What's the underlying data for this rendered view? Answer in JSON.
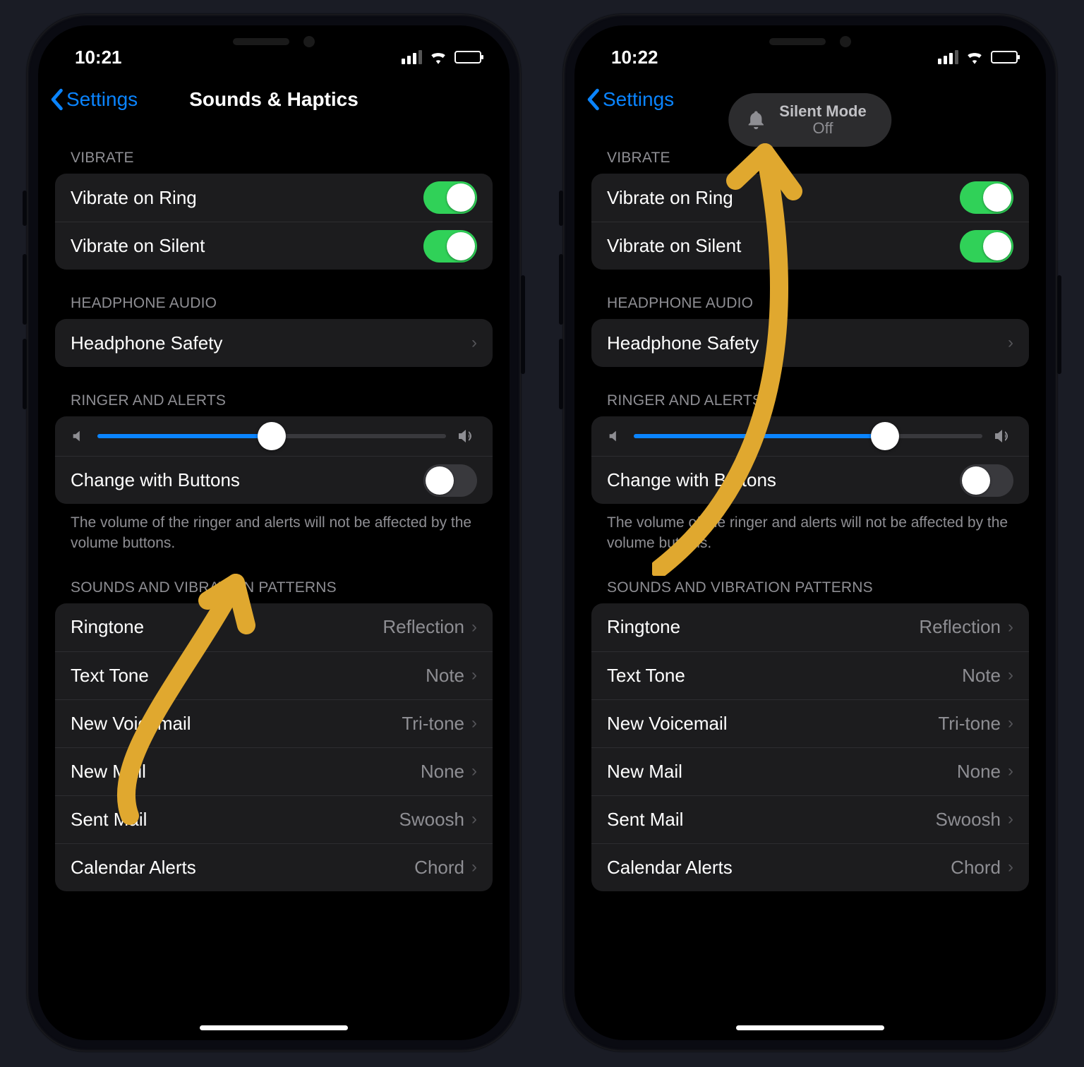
{
  "left": {
    "status": {
      "time": "10:21"
    },
    "nav": {
      "back": "Settings",
      "title": "Sounds & Haptics"
    },
    "vibrate": {
      "header": "VIBRATE",
      "ring": {
        "label": "Vibrate on Ring",
        "on": true
      },
      "silent": {
        "label": "Vibrate on Silent",
        "on": true
      }
    },
    "headphone": {
      "header": "HEADPHONE AUDIO",
      "safety": {
        "label": "Headphone Safety"
      }
    },
    "ringer": {
      "header": "RINGER AND ALERTS",
      "volume_pct": 50,
      "change": {
        "label": "Change with Buttons",
        "on": false
      },
      "footer": "The volume of the ringer and alerts will not be affected by the volume buttons."
    },
    "sounds": {
      "header": "SOUNDS AND VIBRATION PATTERNS",
      "items": [
        {
          "label": "Ringtone",
          "value": "Reflection"
        },
        {
          "label": "Text Tone",
          "value": "Note"
        },
        {
          "label": "New Voicemail",
          "value": "Tri-tone"
        },
        {
          "label": "New Mail",
          "value": "None"
        },
        {
          "label": "Sent Mail",
          "value": "Swoosh"
        },
        {
          "label": "Calendar Alerts",
          "value": "Chord"
        }
      ]
    }
  },
  "right": {
    "status": {
      "time": "10:22"
    },
    "nav": {
      "back": "Settings",
      "title": ""
    },
    "silent_pill": {
      "title": "Silent Mode",
      "state": "Off"
    },
    "vibrate": {
      "header": "VIBRATE",
      "ring": {
        "label": "Vibrate on Ring",
        "on": true
      },
      "silent": {
        "label": "Vibrate on Silent",
        "on": true
      }
    },
    "headphone": {
      "header": "HEADPHONE AUDIO",
      "safety": {
        "label": "Headphone Safety"
      }
    },
    "ringer": {
      "header": "RINGER AND ALERTS",
      "volume_pct": 72,
      "change": {
        "label": "Change with Buttons",
        "on": false
      },
      "footer": "The volume of the ringer and alerts will not be affected by the volume buttons."
    },
    "sounds": {
      "header": "SOUNDS AND VIBRATION PATTERNS",
      "items": [
        {
          "label": "Ringtone",
          "value": "Reflection"
        },
        {
          "label": "Text Tone",
          "value": "Note"
        },
        {
          "label": "New Voicemail",
          "value": "Tri-tone"
        },
        {
          "label": "New Mail",
          "value": "None"
        },
        {
          "label": "Sent Mail",
          "value": "Swoosh"
        },
        {
          "label": "Calendar Alerts",
          "value": "Chord"
        }
      ]
    }
  }
}
